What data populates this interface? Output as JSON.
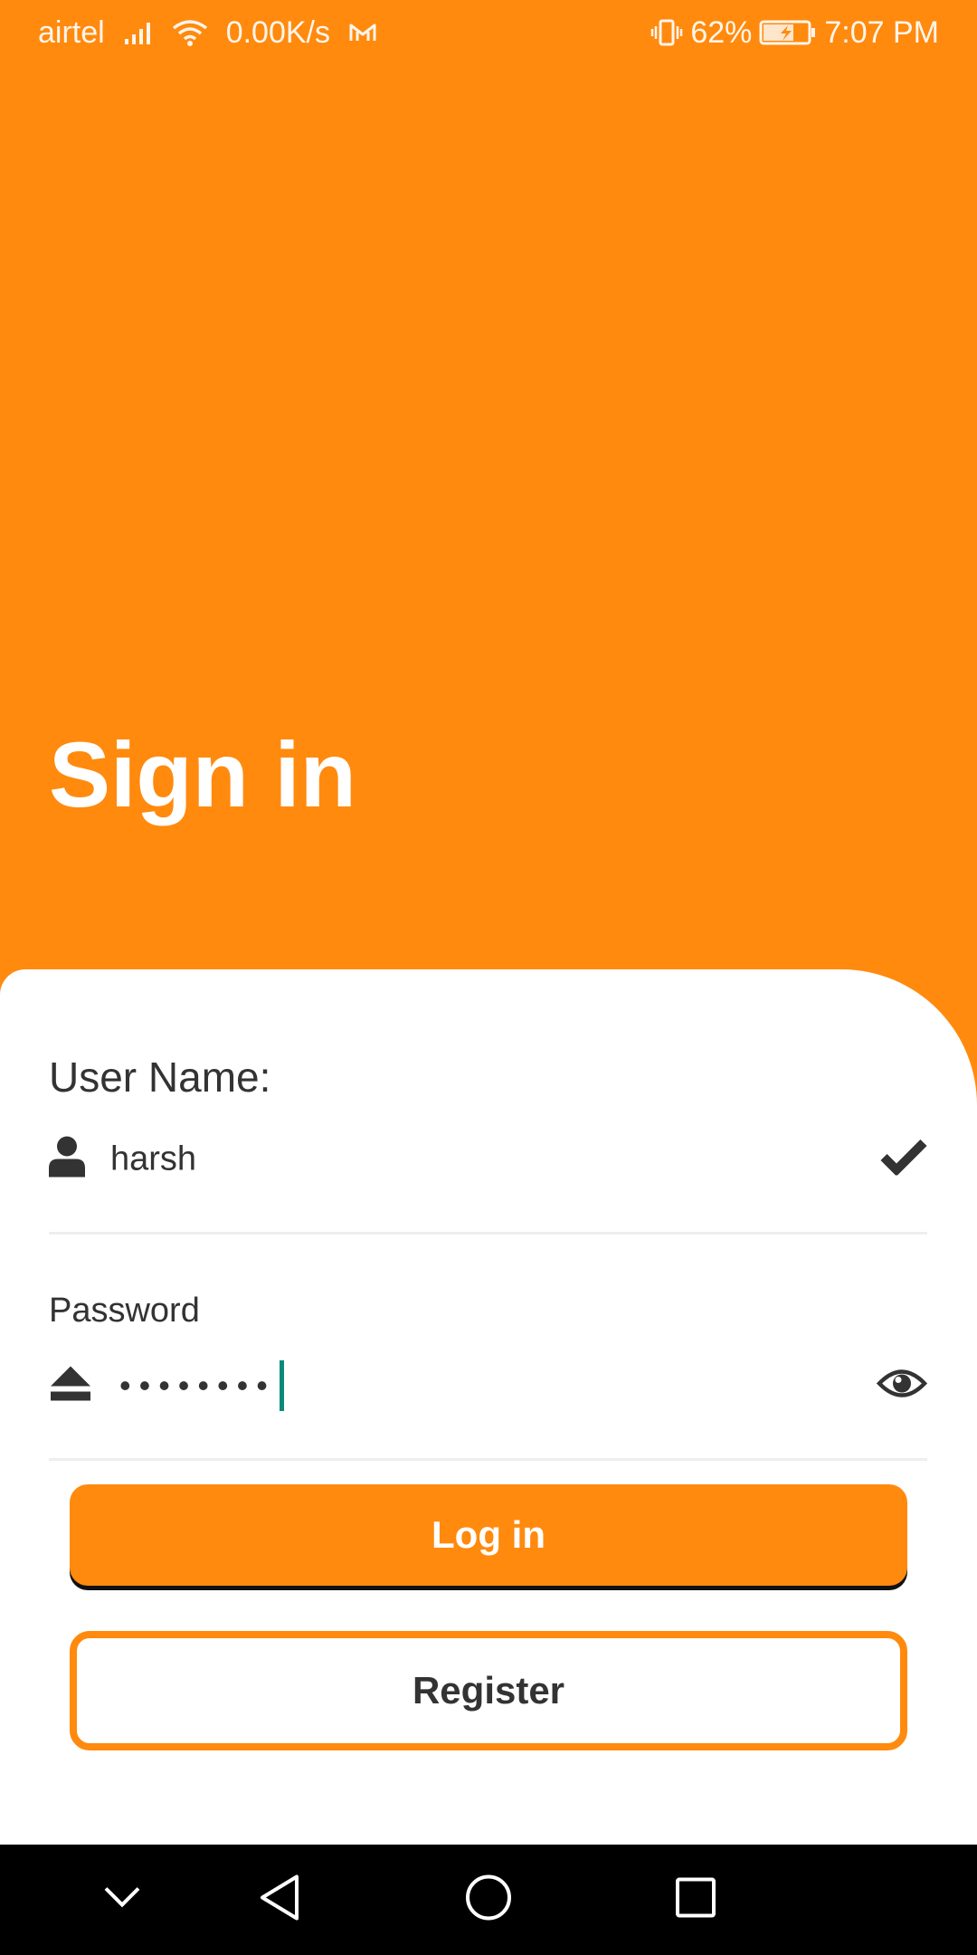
{
  "status_bar": {
    "carrier": "airtel",
    "net_speed": "0.00K/s",
    "battery": "62%",
    "time": "7:07 PM"
  },
  "page": {
    "title": "Sign in"
  },
  "form": {
    "username_label": "User Name:",
    "username_value": "harsh",
    "password_label": "Password",
    "password_value_masked": "••••••••",
    "login_label": "Log in",
    "register_label": "Register"
  },
  "colors": {
    "brand_orange": "#ff8a0e",
    "caret_teal": "#0b8a7a",
    "text_dark": "#333333"
  },
  "icons": {
    "status": [
      "signal-icon",
      "wifi-icon",
      "mail-icon",
      "vibrate-icon",
      "battery-charging-icon"
    ],
    "username_leading": "user-icon",
    "username_trailing": "check-icon",
    "password_leading": "eject-icon",
    "password_trailing": "eye-icon",
    "nav": [
      "chevron-down-icon",
      "back-icon",
      "home-icon",
      "recents-icon"
    ]
  }
}
